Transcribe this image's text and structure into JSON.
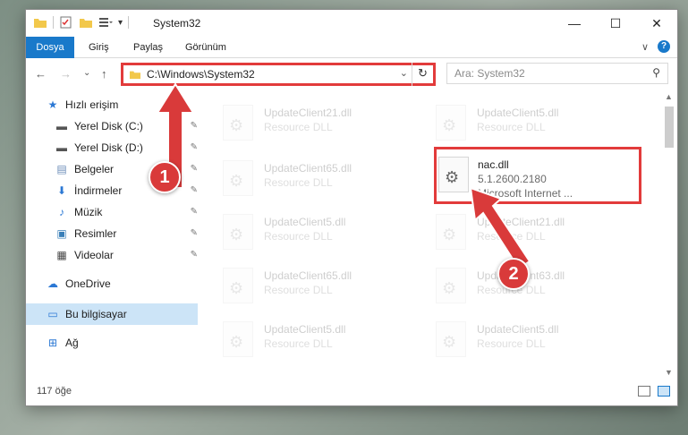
{
  "window": {
    "title": "System32"
  },
  "window_controls": {
    "minimize": "—",
    "maximize": "☐",
    "close": "✕"
  },
  "ribbon": {
    "tabs": [
      {
        "label": "Dosya"
      },
      {
        "label": "Giriş"
      },
      {
        "label": "Paylaş"
      },
      {
        "label": "Görünüm"
      }
    ],
    "expand": "∨",
    "help": "?"
  },
  "address": {
    "path": "C:\\Windows\\System32",
    "dropdown": "⌄",
    "refresh": "↻"
  },
  "nav_buttons": {
    "back": "←",
    "forward": "→",
    "recent": "⌄",
    "up": "↑"
  },
  "search": {
    "placeholder": "Ara: System32",
    "icon": "⚲"
  },
  "sidebar": {
    "items": [
      {
        "label": "Hızlı erişim",
        "icon": "star-icon",
        "glyph": "★",
        "color": "#2b78d4",
        "pinned": false
      },
      {
        "label": "Yerel Disk (C:)",
        "icon": "drive-icon",
        "glyph": "▬",
        "color": "#555555",
        "pinned": true
      },
      {
        "label": "Yerel Disk (D:)",
        "icon": "drive-icon",
        "glyph": "▬",
        "color": "#555555",
        "pinned": true
      },
      {
        "label": "Belgeler",
        "icon": "documents-icon",
        "glyph": "▤",
        "color": "#6b8cb8",
        "pinned": true
      },
      {
        "label": "İndirmeler",
        "icon": "downloads-icon",
        "glyph": "⬇",
        "color": "#2b78d4",
        "pinned": true
      },
      {
        "label": "Müzik",
        "icon": "music-icon",
        "glyph": "♪",
        "color": "#2b78d4",
        "pinned": true
      },
      {
        "label": "Resimler",
        "icon": "pictures-icon",
        "glyph": "▣",
        "color": "#3a7fb8",
        "pinned": true
      },
      {
        "label": "Videolar",
        "icon": "videos-icon",
        "glyph": "▦",
        "color": "#444444",
        "pinned": true
      },
      {
        "label": "OneDrive",
        "icon": "cloud-icon",
        "glyph": "☁",
        "color": "#2b78d4",
        "pinned": false
      },
      {
        "label": "Bu bilgisayar",
        "icon": "computer-icon",
        "glyph": "▭",
        "color": "#2b78d4",
        "pinned": false,
        "selected": true
      },
      {
        "label": "Ağ",
        "icon": "network-icon",
        "glyph": "⊞",
        "color": "#2b78d4",
        "pinned": false
      }
    ],
    "pin_glyph": "📌"
  },
  "files": [
    {
      "name": "UpdateClient21.dll",
      "type": "Resource DLL"
    },
    {
      "name": "UpdateClient5.dll",
      "type": "Resource DLL"
    },
    {
      "name": "UpdateClient65.dll",
      "type": "Resource DLL"
    },
    {
      "name": "nac.dll",
      "type": "5.1.2600.2180",
      "desc": "Microsoft Internet ...",
      "highlighted": true
    },
    {
      "name": "UpdateClient5.dll",
      "type": "Resource DLL"
    },
    {
      "name": "UpdateClient21.dll",
      "type": "Resource DLL"
    },
    {
      "name": "UpdateClient65.dll",
      "type": "Resource DLL"
    },
    {
      "name": "UpdateClient63.dll",
      "type": "Resource DLL"
    },
    {
      "name": "UpdateClient5.dll",
      "type": "Resource DLL"
    },
    {
      "name": "UpdateClient5.dll",
      "type": "Resource DLL"
    }
  ],
  "status": {
    "item_count": "117 öğe"
  },
  "annotations": [
    {
      "number": "1"
    },
    {
      "number": "2"
    }
  ],
  "colors": {
    "accent": "#1979ca",
    "highlight_red": "#e23b3b",
    "badge_red": "#d93a3a",
    "selected": "#cce4f7"
  }
}
